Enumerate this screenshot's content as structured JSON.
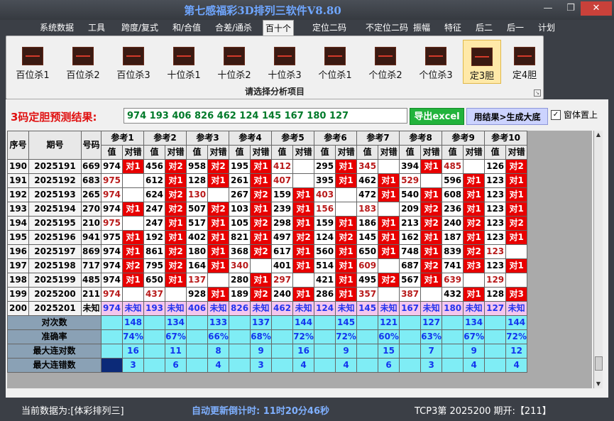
{
  "window": {
    "title": "第七感福彩3D排列三软件V8.80",
    "btn_min": "—",
    "btn_max": "❐",
    "btn_close": "✕"
  },
  "menu": [
    "系统数据",
    "工具",
    "跨度/复式",
    "和/合值",
    "合差/通杀",
    "百十个",
    "定位二码",
    "不定位二码",
    "振幅",
    "特征",
    "后二",
    "后一",
    "计划"
  ],
  "menu_active": 5,
  "ribbon": {
    "buttons": [
      "百位杀1",
      "百位杀2",
      "百位杀3",
      "十位杀1",
      "十位杀2",
      "十位杀3",
      "个位杀1",
      "个位杀2",
      "个位杀3",
      "定3胆",
      "定4胆"
    ],
    "active": 9,
    "caption": "请选择分析项目"
  },
  "prediction": {
    "label": "3码定胆预测结果:",
    "value": "974 193 406 826 462 124 145 167 180 127",
    "export_btn": "导出excel",
    "generate_btn": "用结果>生成大底",
    "checkbox_checked": true,
    "checkbox_label": "窗体置上"
  },
  "table": {
    "col_seq": "序号",
    "col_issue": "期号",
    "col_num": "号码",
    "refs": [
      "参考1",
      "参考2",
      "参考3",
      "参考4",
      "参考5",
      "参考6",
      "参考7",
      "参考8",
      "参考9",
      "参考10"
    ],
    "sub_val": "值",
    "sub_check": "对错",
    "rows": [
      {
        "seq": "190",
        "issue": "2025191",
        "num": "669",
        "cells": [
          [
            "974",
            1
          ],
          [
            "456",
            2
          ],
          [
            "958",
            2
          ],
          [
            "195",
            1
          ],
          [
            "412",
            0
          ],
          [
            "295",
            1
          ],
          [
            "345",
            0
          ],
          [
            "394",
            1
          ],
          [
            "485",
            0
          ],
          [
            "126",
            2
          ]
        ]
      },
      {
        "seq": "191",
        "issue": "2025192",
        "num": "683",
        "cells": [
          [
            "975",
            0
          ],
          [
            "612",
            1
          ],
          [
            "128",
            1
          ],
          [
            "261",
            1
          ],
          [
            "407",
            0
          ],
          [
            "395",
            1
          ],
          [
            "462",
            1
          ],
          [
            "529",
            0
          ],
          [
            "596",
            1
          ],
          [
            "123",
            1
          ]
        ]
      },
      {
        "seq": "192",
        "issue": "2025193",
        "num": "265",
        "cells": [
          [
            "974",
            0
          ],
          [
            "624",
            2
          ],
          [
            "130",
            0
          ],
          [
            "267",
            2
          ],
          [
            "159",
            1
          ],
          [
            "403",
            0
          ],
          [
            "472",
            1
          ],
          [
            "540",
            1
          ],
          [
            "608",
            1
          ],
          [
            "123",
            1
          ]
        ]
      },
      {
        "seq": "193",
        "issue": "2025194",
        "num": "270",
        "cells": [
          [
            "974",
            1
          ],
          [
            "247",
            2
          ],
          [
            "507",
            2
          ],
          [
            "103",
            1
          ],
          [
            "239",
            1
          ],
          [
            "156",
            0
          ],
          [
            "183",
            0
          ],
          [
            "209",
            2
          ],
          [
            "236",
            1
          ],
          [
            "123",
            1
          ]
        ]
      },
      {
        "seq": "194",
        "issue": "2025195",
        "num": "210",
        "cells": [
          [
            "975",
            0
          ],
          [
            "247",
            1
          ],
          [
            "517",
            1
          ],
          [
            "105",
            2
          ],
          [
            "298",
            1
          ],
          [
            "159",
            1
          ],
          [
            "186",
            1
          ],
          [
            "213",
            2
          ],
          [
            "240",
            2
          ],
          [
            "123",
            2
          ]
        ]
      },
      {
        "seq": "195",
        "issue": "2025196",
        "num": "941",
        "cells": [
          [
            "975",
            1
          ],
          [
            "192",
            1
          ],
          [
            "402",
            1
          ],
          [
            "821",
            1
          ],
          [
            "497",
            2
          ],
          [
            "124",
            2
          ],
          [
            "145",
            1
          ],
          [
            "162",
            1
          ],
          [
            "187",
            1
          ],
          [
            "123",
            1
          ]
        ]
      },
      {
        "seq": "196",
        "issue": "2025197",
        "num": "869",
        "cells": [
          [
            "974",
            1
          ],
          [
            "861",
            2
          ],
          [
            "180",
            1
          ],
          [
            "368",
            2
          ],
          [
            "617",
            1
          ],
          [
            "560",
            1
          ],
          [
            "650",
            1
          ],
          [
            "748",
            1
          ],
          [
            "839",
            2
          ],
          [
            "123",
            0
          ]
        ]
      },
      {
        "seq": "197",
        "issue": "2025198",
        "num": "717",
        "cells": [
          [
            "974",
            2
          ],
          [
            "795",
            2
          ],
          [
            "164",
            1
          ],
          [
            "340",
            0
          ],
          [
            "401",
            1
          ],
          [
            "514",
            1
          ],
          [
            "609",
            0
          ],
          [
            "687",
            2
          ],
          [
            "741",
            3
          ],
          [
            "123",
            1
          ]
        ]
      },
      {
        "seq": "198",
        "issue": "2025199",
        "num": "485",
        "cells": [
          [
            "974",
            1
          ],
          [
            "650",
            1
          ],
          [
            "137",
            0
          ],
          [
            "280",
            1
          ],
          [
            "297",
            0
          ],
          [
            "421",
            1
          ],
          [
            "495",
            2
          ],
          [
            "567",
            1
          ],
          [
            "639",
            0
          ],
          [
            "129",
            0
          ]
        ]
      },
      {
        "seq": "199",
        "issue": "2025200",
        "num": "211",
        "cells": [
          [
            "974",
            0
          ],
          [
            "437",
            0
          ],
          [
            "928",
            1
          ],
          [
            "189",
            2
          ],
          [
            "240",
            1
          ],
          [
            "286",
            1
          ],
          [
            "357",
            0
          ],
          [
            "387",
            0
          ],
          [
            "432",
            1
          ],
          [
            "128",
            3
          ]
        ]
      }
    ],
    "pred_row": {
      "seq": "200",
      "issue": "2025201",
      "num": "未知",
      "vals": [
        "974",
        "193",
        "406",
        "826",
        "462",
        "124",
        "145",
        "167",
        "180",
        "127"
      ],
      "unknown": "未知"
    },
    "stats": [
      {
        "label": "对次数",
        "vals": [
          "148",
          "134",
          "133",
          "137",
          "144",
          "145",
          "121",
          "127",
          "134",
          "144"
        ]
      },
      {
        "label": "准确率",
        "vals": [
          "74%",
          "67%",
          "66%",
          "68%",
          "72%",
          "72%",
          "60%",
          "63%",
          "67%",
          "72%"
        ]
      },
      {
        "label": "最大连对数",
        "vals": [
          "16",
          "11",
          "8",
          "9",
          "16",
          "9",
          "15",
          "7",
          "9",
          "12"
        ]
      },
      {
        "label": "最大连错数",
        "vals": [
          "3",
          "6",
          "4",
          "3",
          "4",
          "4",
          "6",
          "3",
          "4",
          "4"
        ]
      }
    ],
    "check_prefix": "对"
  },
  "status": {
    "current": "当前数据为:[体彩排列三]",
    "countdown": "自动更新倒计时:  11时20分46秒",
    "right": "TCP3第 2025200 期开:【211】"
  }
}
